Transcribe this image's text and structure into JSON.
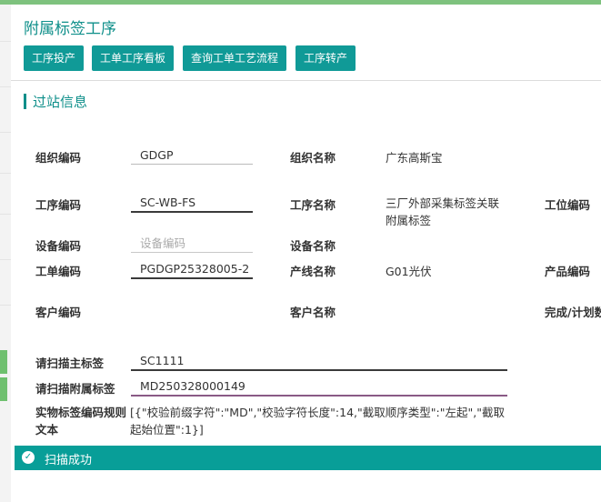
{
  "page": {
    "title": "附属标签工序"
  },
  "toolbar": {
    "buttons": [
      "工序投产",
      "工单工序看板",
      "查询工单工艺流程",
      "工序转产"
    ]
  },
  "section": {
    "title": "过站信息"
  },
  "form": {
    "org_code_label": "组织编码",
    "org_code": "GDGP",
    "org_name_label": "组织名称",
    "org_name": "广东高斯宝",
    "proc_code_label": "工序编码",
    "proc_code": "SC-WB-FS",
    "proc_name_label": "工序名称",
    "proc_name_1": "三厂外部采集标签关联",
    "proc_name_2": "附属标签",
    "station_code_label": "工位编码",
    "device_code_label": "设备编码",
    "device_code_placeholder": "设备编码",
    "device_name_label": "设备名称",
    "order_code_label": "工单编码",
    "order_code": "PGDGP25328005-2",
    "line_name_label": "产线名称",
    "line_name": "G01光伏",
    "product_code_label": "产品编码",
    "customer_code_label": "客户编码",
    "customer_name_label": "客户名称",
    "completion_label": "完成/计划数",
    "scan_main_label": "请扫描主标签",
    "scan_main": "SC1111",
    "scan_sub_label": "请扫描附属标签",
    "scan_sub": "MD250328000149",
    "rule_label_1": "实物标签编码规则",
    "rule_label_2": "文本",
    "rule_text_1": "[{\"校验前缀字符\":\"MD\",\"校验字符长度\":14,\"截取顺序类型\":\"左起\",\"截取",
    "rule_text_2": "起始位置\":1}]"
  },
  "status": {
    "icon": "check-circle-icon",
    "message": "扫描成功",
    "color": "#089e98"
  }
}
